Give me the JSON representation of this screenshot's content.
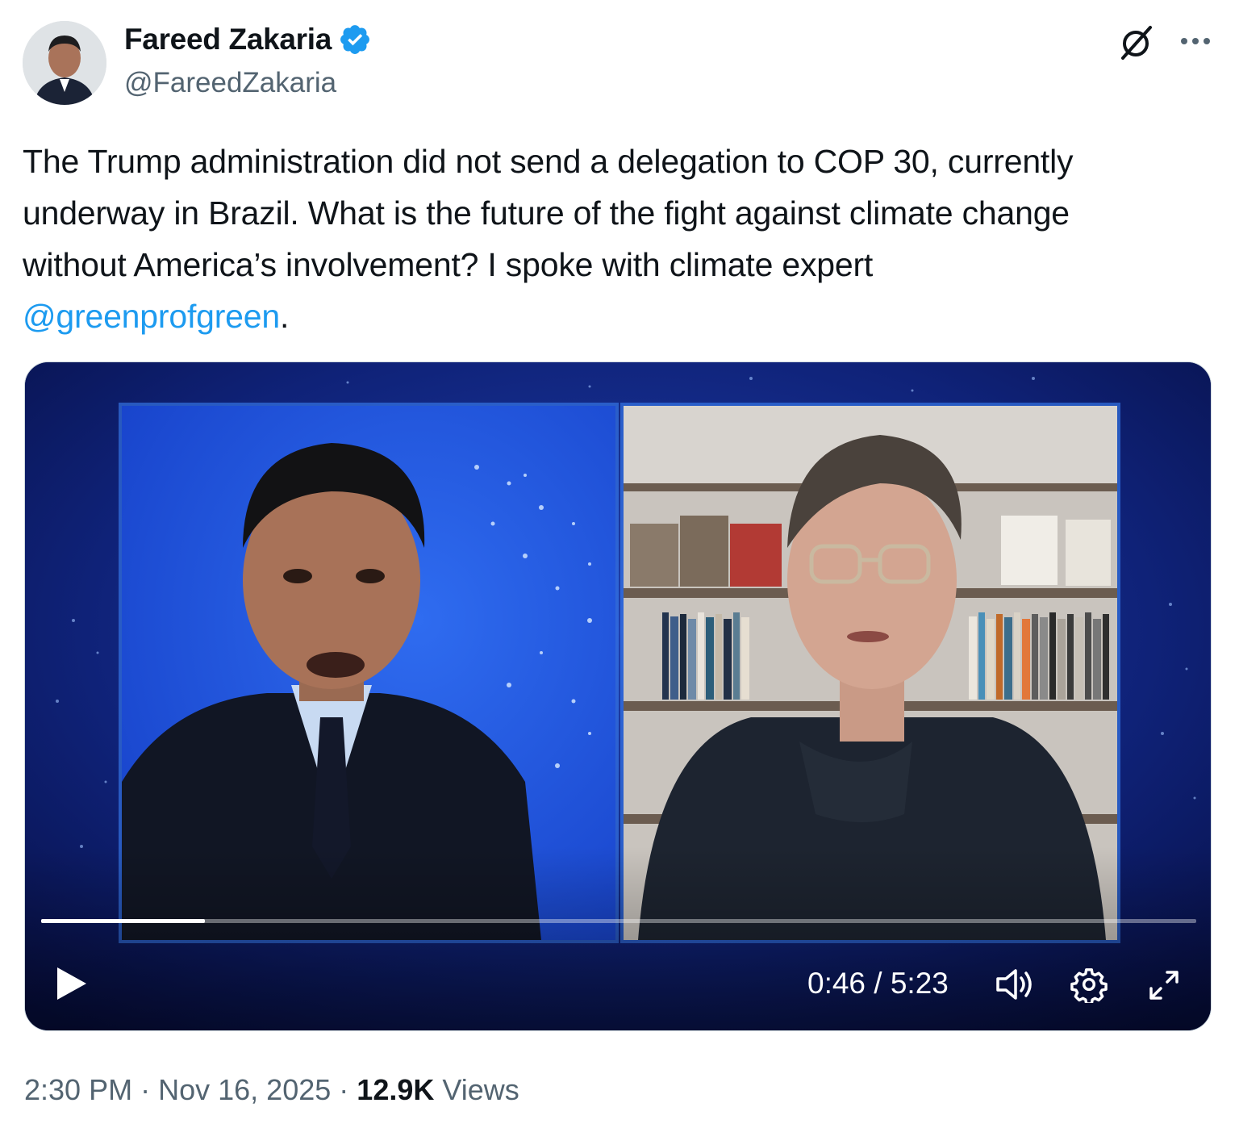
{
  "author": {
    "display_name": "Fareed Zakaria",
    "handle": "@FareedZakaria",
    "verified": true,
    "avatar_icon": "profile-photo"
  },
  "header_icons": {
    "grok": "grok-icon",
    "more": "more-options-icon"
  },
  "tweet": {
    "text_lines": [
      "The Trump administration did not send a delegation to COP 30, currently",
      "underway in Brazil. What is the future of the fight against climate change",
      "without America’s involvement? I spoke with climate expert"
    ],
    "mention": "@greenprofgreen",
    "trailing": "."
  },
  "video": {
    "current_time": "0:46",
    "separator": "/",
    "duration": "5:23",
    "progress_fraction": 0.142,
    "controls": {
      "play": "play-icon",
      "volume": "volume-icon",
      "settings": "settings-gear-icon",
      "fullscreen": "fullscreen-icon"
    }
  },
  "meta": {
    "time": "2:30 PM",
    "dot": "·",
    "date": "Nov 16, 2025",
    "views_count": "12.9K",
    "views_label": "Views"
  },
  "colors": {
    "text": "#0f1419",
    "secondary": "#536471",
    "link": "#1d9bf0",
    "verified": "#1d9bf0",
    "video_bg": "#0d1a5c"
  }
}
